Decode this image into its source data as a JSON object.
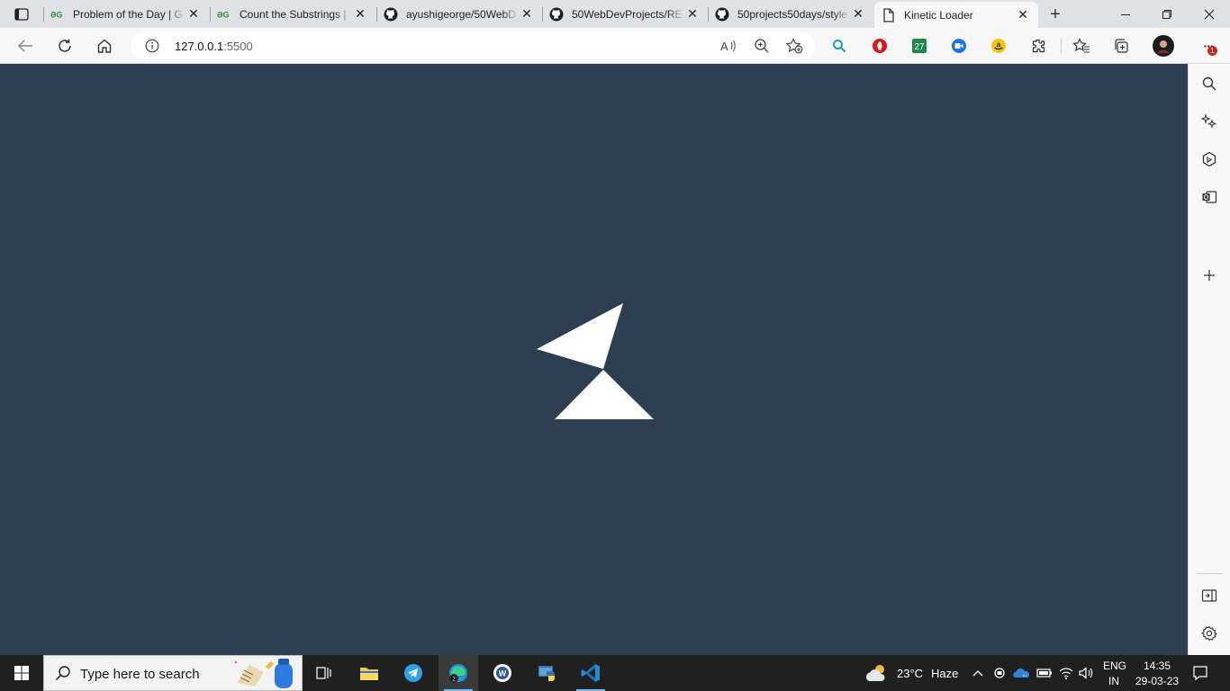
{
  "browser": {
    "tabs": [
      {
        "title": "Problem of the Day | G",
        "favicon": "geeksforgeeks-icon",
        "active": false
      },
      {
        "title": "Count the Substrings |",
        "favicon": "geeksforgeeks-icon",
        "active": false
      },
      {
        "title": "ayushigeorge/50WebD",
        "favicon": "github-icon",
        "active": false
      },
      {
        "title": "50WebDevProjects/RE",
        "favicon": "github-icon",
        "active": false
      },
      {
        "title": "50projects50days/style",
        "favicon": "github-icon",
        "active": false
      },
      {
        "title": "Kinetic Loader",
        "favicon": "page-icon",
        "active": true
      }
    ],
    "close_glyph": "✕",
    "new_tab_glyph": "+",
    "address": {
      "host": "127.0.0.1",
      "port": ":5500"
    },
    "extensions": {
      "calendar_badge": "27",
      "notification_badge": "1",
      "more_glyph": "···"
    }
  },
  "page": {
    "title": "Kinetic Loader",
    "background": "#2c3e50",
    "loader_color": "#ffffff"
  },
  "taskbar": {
    "search_placeholder": "Type here to search",
    "weather": {
      "temp": "23°C",
      "condition": "Haze"
    },
    "language": {
      "lang": "ENG",
      "region": "IN"
    },
    "clock": {
      "time": "14:35",
      "date": "29-03-23"
    }
  }
}
